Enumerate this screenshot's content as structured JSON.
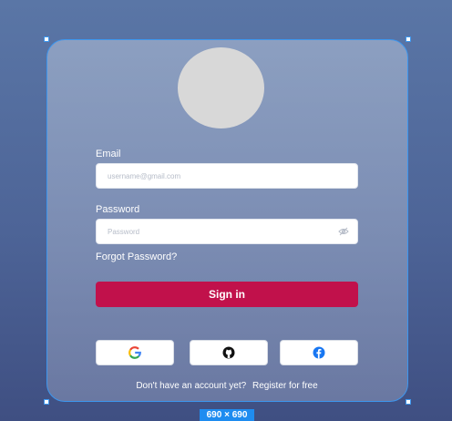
{
  "form": {
    "email_label": "Email",
    "email_placeholder": "username@gmail.com",
    "password_label": "Password",
    "password_placeholder": "Password",
    "forgot_label": "Forgot Password?",
    "signin_label": "Sign in",
    "footer_prefix": "Don't have an account yet?",
    "footer_link": "Register for free"
  },
  "social": [
    {
      "name": "google",
      "icon": "google-icon"
    },
    {
      "name": "github",
      "icon": "github-icon"
    },
    {
      "name": "facebook",
      "icon": "facebook-icon"
    }
  ],
  "canvas": {
    "dimension_badge": "690 × 690"
  },
  "colors": {
    "accent": "#c1114b",
    "selection": "#3d96ee"
  }
}
